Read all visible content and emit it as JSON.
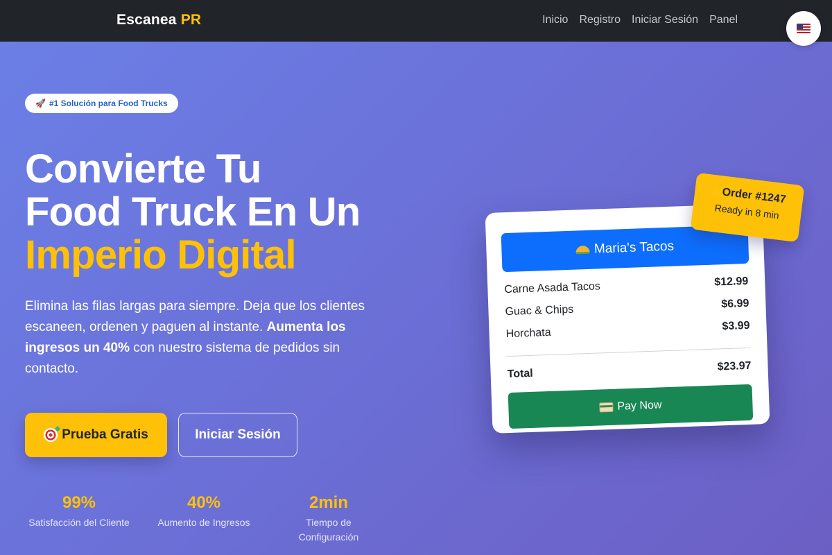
{
  "navbar": {
    "brand_main": "Escanea",
    "brand_accent": "PR",
    "links": [
      "Inicio",
      "Registro",
      "Iniciar Sesión",
      "Panel"
    ],
    "language_icon": "us-flag-icon"
  },
  "hero": {
    "badge": "#1 Solución para Food Trucks",
    "badge_icon": "rocket-icon",
    "title_line1": "Convierte Tu",
    "title_line2": "Food Truck En Un",
    "title_line3": "Imperio Digital",
    "desc_part1": "Elimina las filas largas para siempre. Deja que los clientes escaneen, ordenen y paguen al instante. ",
    "desc_bold": "Aumenta los ingresos un 40%",
    "desc_part2": " con nuestro sistema de pedidos sin contacto.",
    "primary_button": "Prueba Gratis",
    "primary_button_icon": "target-icon",
    "secondary_button": "Iniciar Sesión",
    "stats": [
      {
        "value": "99%",
        "label": "Satisfacción del Cliente"
      },
      {
        "value": "40%",
        "label": "Aumento de Ingresos"
      },
      {
        "value": "2min",
        "label": "Tiempo de Configuración"
      }
    ]
  },
  "order_card": {
    "restaurant": "Maria's Tacos",
    "restaurant_icon": "taco-icon",
    "items": [
      {
        "name": "Carne Asada Tacos",
        "price": "$12.99"
      },
      {
        "name": "Guac & Chips",
        "price": "$6.99"
      },
      {
        "name": "Horchata",
        "price": "$3.99"
      }
    ],
    "total_label": "Total",
    "total_value": "$23.97",
    "pay_button": "Pay Now",
    "pay_icon": "credit-card-icon"
  },
  "order_badge": {
    "title": "Order #1247",
    "subtitle": "Ready in 8 min",
    "icon": "lightning-icon"
  },
  "colors": {
    "navbar_bg": "#212529",
    "accent_yellow": "#ffc107",
    "hero_gradient_start": "#6b7fe6",
    "hero_gradient_end": "#6c5fc4",
    "card_header_blue": "#0d6efd",
    "pay_green": "#198754"
  }
}
